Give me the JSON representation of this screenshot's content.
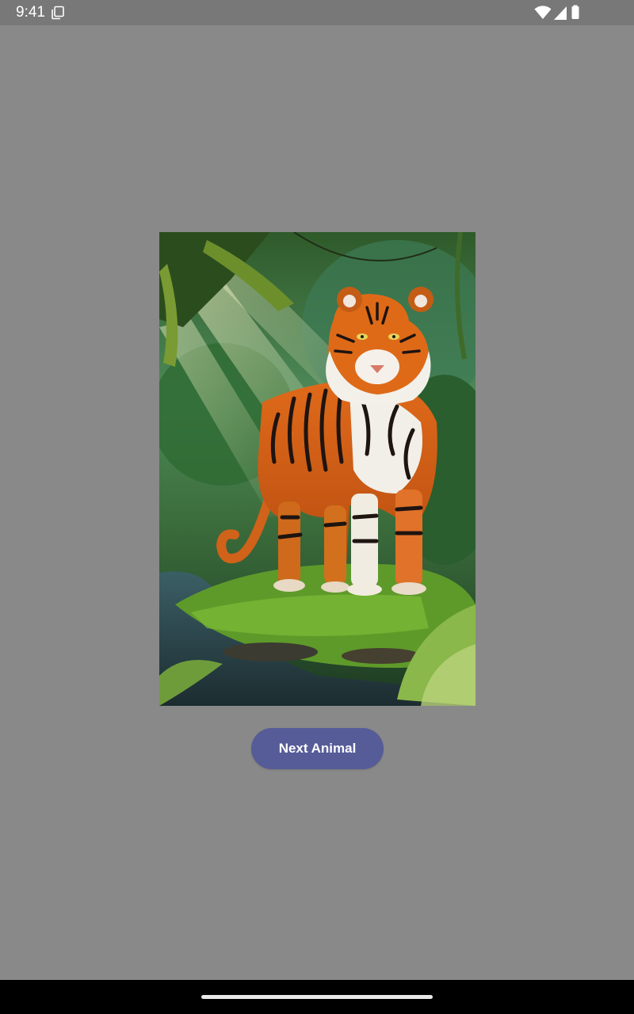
{
  "status_bar": {
    "time": "9:41",
    "left_icon": "screenshot-copy-icon",
    "right_icons": [
      "wifi-icon",
      "cellular-signal-icon",
      "battery-icon"
    ]
  },
  "main": {
    "image_subject": "tiger",
    "image_alt": "Tiger",
    "button_label": "Next Animal"
  },
  "colors": {
    "background": "#898989",
    "status_bar": "#787878",
    "button": "#565c98",
    "nav_bar": "#000000"
  }
}
